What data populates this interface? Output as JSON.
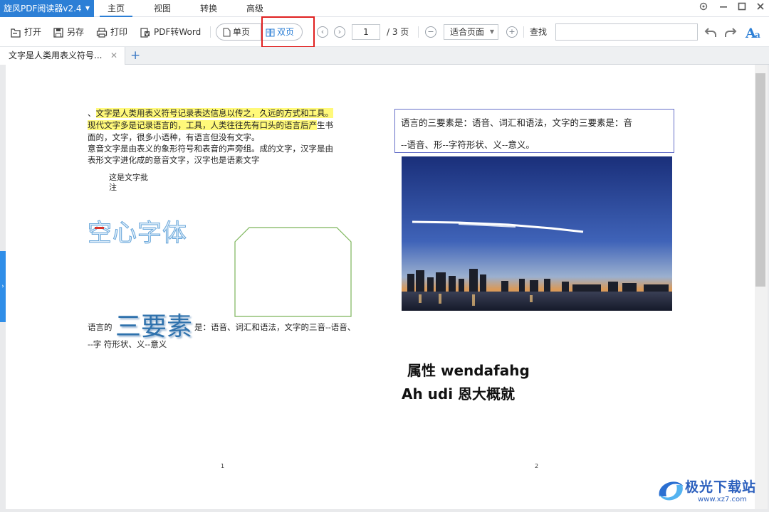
{
  "app": {
    "title": "旋风PDF阅读器v2.4"
  },
  "menu": [
    {
      "label": "主页"
    },
    {
      "label": "视图"
    },
    {
      "label": "转换"
    },
    {
      "label": "高级"
    }
  ],
  "toolbar": {
    "open": "打开",
    "saveas": "另存",
    "print": "打印",
    "toword": "PDF转Word",
    "single": "单页",
    "double": "双页",
    "current_page": "1",
    "total_pages": "/ 3 页",
    "zoom": "适合页面",
    "find": "查找",
    "search_value": ""
  },
  "tabs": [
    {
      "label": "文字是人类用表义符号..."
    }
  ],
  "page1": {
    "line1_prefix": "、",
    "line1": "文字是人类用表义符号记录表达信息以传之，久远的方式和工具。",
    "line2_hl": "现代文字多是记录语言的，工具，人类往往先有口头的语言后产",
    "line2_tail": "生书",
    "line3": "面的，文字，很多小语种，有语言但没有文字。",
    "line4": "意音文字是由表义的象形符号和表音的声旁组。成的文字，汉字是由",
    "line5": "表形文字进化成的意音文字，汉字也是语素文字",
    "note1": "这是文字批",
    "note2": "注",
    "hollow": "空心字体",
    "para_prefix": "语言的",
    "big_text": "三要素",
    "para_tail": "是：语音、词汇和语法，文字的三音--语音、",
    "para_line2": "--字  符形状、义--意义",
    "page_number": "1"
  },
  "page2": {
    "box_line1": "语言的三要素是：语音、词汇和语法，文字的三要素是：音",
    "box_line2": "--语音、形--字符形状、义--意义。",
    "bold1": "属性 wendafahg",
    "bold2": "Ah udi 恩大概就",
    "page_number": "2"
  },
  "watermark": {
    "text": "极光下载站",
    "url": "www.xz7.com"
  },
  "colors": {
    "accent": "#2c7fd6",
    "highlight": "#fff97a",
    "annotation_box": "#e02020"
  }
}
